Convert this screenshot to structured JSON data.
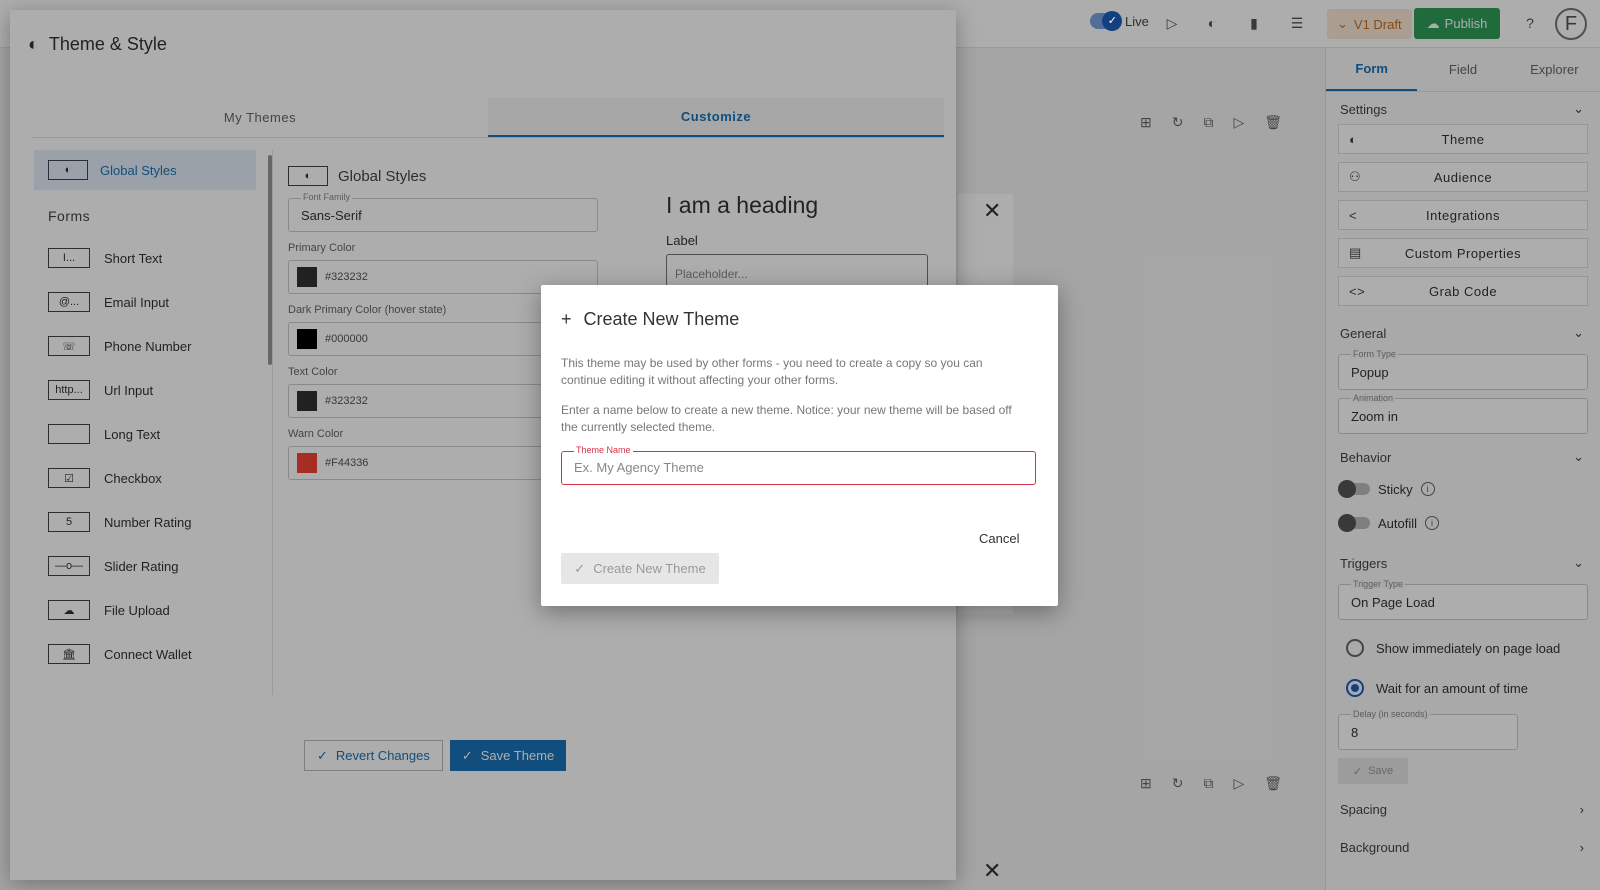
{
  "topbar": {
    "live_label": "Live",
    "draft_label": "V1 Draft",
    "publish_label": "Publish",
    "avatar_letter": "F"
  },
  "right_panel": {
    "tabs": [
      "Form",
      "Field",
      "Explorer"
    ],
    "settings_heading": "Settings",
    "settings_buttons": [
      "Theme",
      "Audience",
      "Integrations",
      "Custom Properties",
      "Grab Code"
    ],
    "general_heading": "General",
    "form_type_label": "Form Type",
    "form_type_value": "Popup",
    "animation_label": "Animation",
    "animation_value": "Zoom in",
    "behavior_heading": "Behavior",
    "sticky_label": "Sticky",
    "autofill_label": "Autofill",
    "triggers_heading": "Triggers",
    "trigger_type_label": "Trigger Type",
    "trigger_type_value": "On Page Load",
    "radio_1": "Show immediately on page load",
    "radio_2": "Wait for an amount of time",
    "delay_label": "Delay (in seconds)",
    "delay_value": "8",
    "save_label": "Save",
    "spacing_heading": "Spacing",
    "background_heading": "Background"
  },
  "theme_dialog": {
    "title": "Theme & Style",
    "tabs": [
      "My Themes",
      "Customize"
    ],
    "sidebar_global": "Global Styles",
    "forms_heading": "Forms",
    "form_items": [
      {
        "icon": "I...",
        "label": "Short Text"
      },
      {
        "icon": "@...",
        "label": "Email Input"
      },
      {
        "icon": "☏",
        "label": "Phone Number"
      },
      {
        "icon": "http...",
        "label": "Url Input"
      },
      {
        "icon": "",
        "label": "Long Text"
      },
      {
        "icon": "☑",
        "label": "Checkbox"
      },
      {
        "icon": "5",
        "label": "Number Rating"
      },
      {
        "icon": "—o—",
        "label": "Slider Rating"
      },
      {
        "icon": "☁",
        "label": "File Upload"
      },
      {
        "icon": "🏛",
        "label": "Connect Wallet"
      }
    ],
    "form_heading": "Global Styles",
    "font_family_label": "Font Family",
    "font_family_value": "Sans-Serif",
    "primary_color_label": "Primary Color",
    "primary_color_value": "#323232",
    "dark_primary_label": "Dark Primary Color (hover state)",
    "dark_primary_value": "#000000",
    "text_color_label": "Text Color",
    "text_color_value": "#323232",
    "warn_color_label": "Warn Color",
    "warn_color_value": "#F44336",
    "preview_heading": "I am a heading",
    "preview_label": "Label",
    "preview_placeholder": "Placeholder...",
    "revert_label": "Revert Changes",
    "save_label": "Save Theme"
  },
  "create_dialog": {
    "title": "Create New Theme",
    "para1": "This theme may be used by other forms - you need to create a copy so you can continue editing it without affecting your other forms.",
    "para2": "Enter a name below to create a new theme. Notice: your new theme will be based off the currently selected theme.",
    "field_label": "Theme Name",
    "field_placeholder": "Ex. My Agency Theme",
    "cancel_label": "Cancel",
    "create_label": "Create New Theme"
  },
  "colors": {
    "accent": "#1a73b8",
    "publish": "#2e9e58",
    "warn": "#F44336",
    "draft": "#c96d19"
  }
}
